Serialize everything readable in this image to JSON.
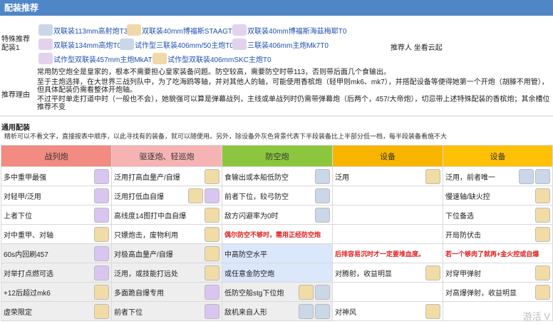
{
  "header": {
    "title": "配装推荐"
  },
  "recommendation": {
    "label": "特殊推荐配装1",
    "recommender": "推荐人 坐看云起",
    "items": [
      "双联装113mm高射炮T3",
      "双联装40mm博福斯STAAGT0",
      "双联装40mm博福斯海茲梅耶T0",
      "双联装134mm高炮T0",
      "试作型三联装406mm/50主炮T0",
      "三联装406mm主炮Mk7T0",
      "试作型双联装457mm主炮MkAT0",
      "试作型双联装406mmSKC主炮T0"
    ],
    "reason_label": "推荐理由",
    "reasons": [
      "常用防空炮全是皇家的，根本不需要担心皇家装备问题。防空较高，需要防空时带113，否则带后面几个食输出。",
      "至于主炮选择，在大世界三战列队中，为了吃海鸥等轴，并对其他人的轴，可能使用香槟炮（轻甲则mk6、mk7），并搭配设备等便得她第一个开炮（胡滕不用管），但具体配装仍需看整体开炮轴。",
      "不过平时单走打道中时（一般也不会），她貌强可以算是弹幕战列，主线或单战列时仍需带弹幕炮（后两个，457/大帝炮），切忌带上述特殊配装的香槟炮；其余槽位推荐不变"
    ]
  },
  "general": {
    "title": "通用配装",
    "note": "精析可以不看文字，直接按表中顺序，以此寻找有的装备，就可以随便用。另外，除设备外灰色背景代表下半段装备比上半部分低一档，每半段装备看施不大",
    "headers": [
      "战列炮",
      "驱逐炮、轻巡炮",
      "防空炮",
      "设备",
      "设备"
    ],
    "rows": [
      [
        "多中重甲最强",
        "泛用打高血量产/自爆",
        "食输出或本船低防空",
        "泛用",
        "泛用，前者唯一"
      ],
      [
        "对轻甲/泛用",
        "泛用打低血自爆",
        "前者下位，较弓防空",
        "",
        "慢速轴/缺火控"
      ],
      [
        "上者下位",
        "高线度14图打中血自爆",
        "敌方闪避率为0时",
        "",
        "下位备选"
      ],
      [
        "对中重甲、对轴",
        "只嫖炮击，废物利用",
        "偶尔防空不够时，需用正经防空炮",
        "",
        "开局防伏击"
      ],
      [
        "60s内回刷457",
        "对极高血量产/自爆",
        "中高防空水平",
        "后排容易沉时才一定要堆血度。",
        "若一个够肉了就再+金火控或自爆"
      ],
      [
        "对举打点燃可选",
        "泛用，或技能打远处",
        "或任意金防空炮",
        "对腾射，收益明显",
        "对穿甲弹射"
      ],
      [
        "+12后超过mk6",
        "多面跪自爆专用",
        "低防空船stg下位炮",
        "",
        "对高爆弹射，收益明显"
      ],
      [
        "虚荣限定",
        "前者下位",
        "敌机来自人形",
        "对神风",
        ""
      ]
    ]
  },
  "watermark": "游活 V",
  "colors": {
    "header_bar": "#4f86c6",
    "battleship": "#f28b82",
    "destroyer": "#f6b3b3",
    "antiair": "#8cc63f",
    "equipment": "#f7b500",
    "equipment2": "#ffc107",
    "note_red": "#e02020"
  }
}
